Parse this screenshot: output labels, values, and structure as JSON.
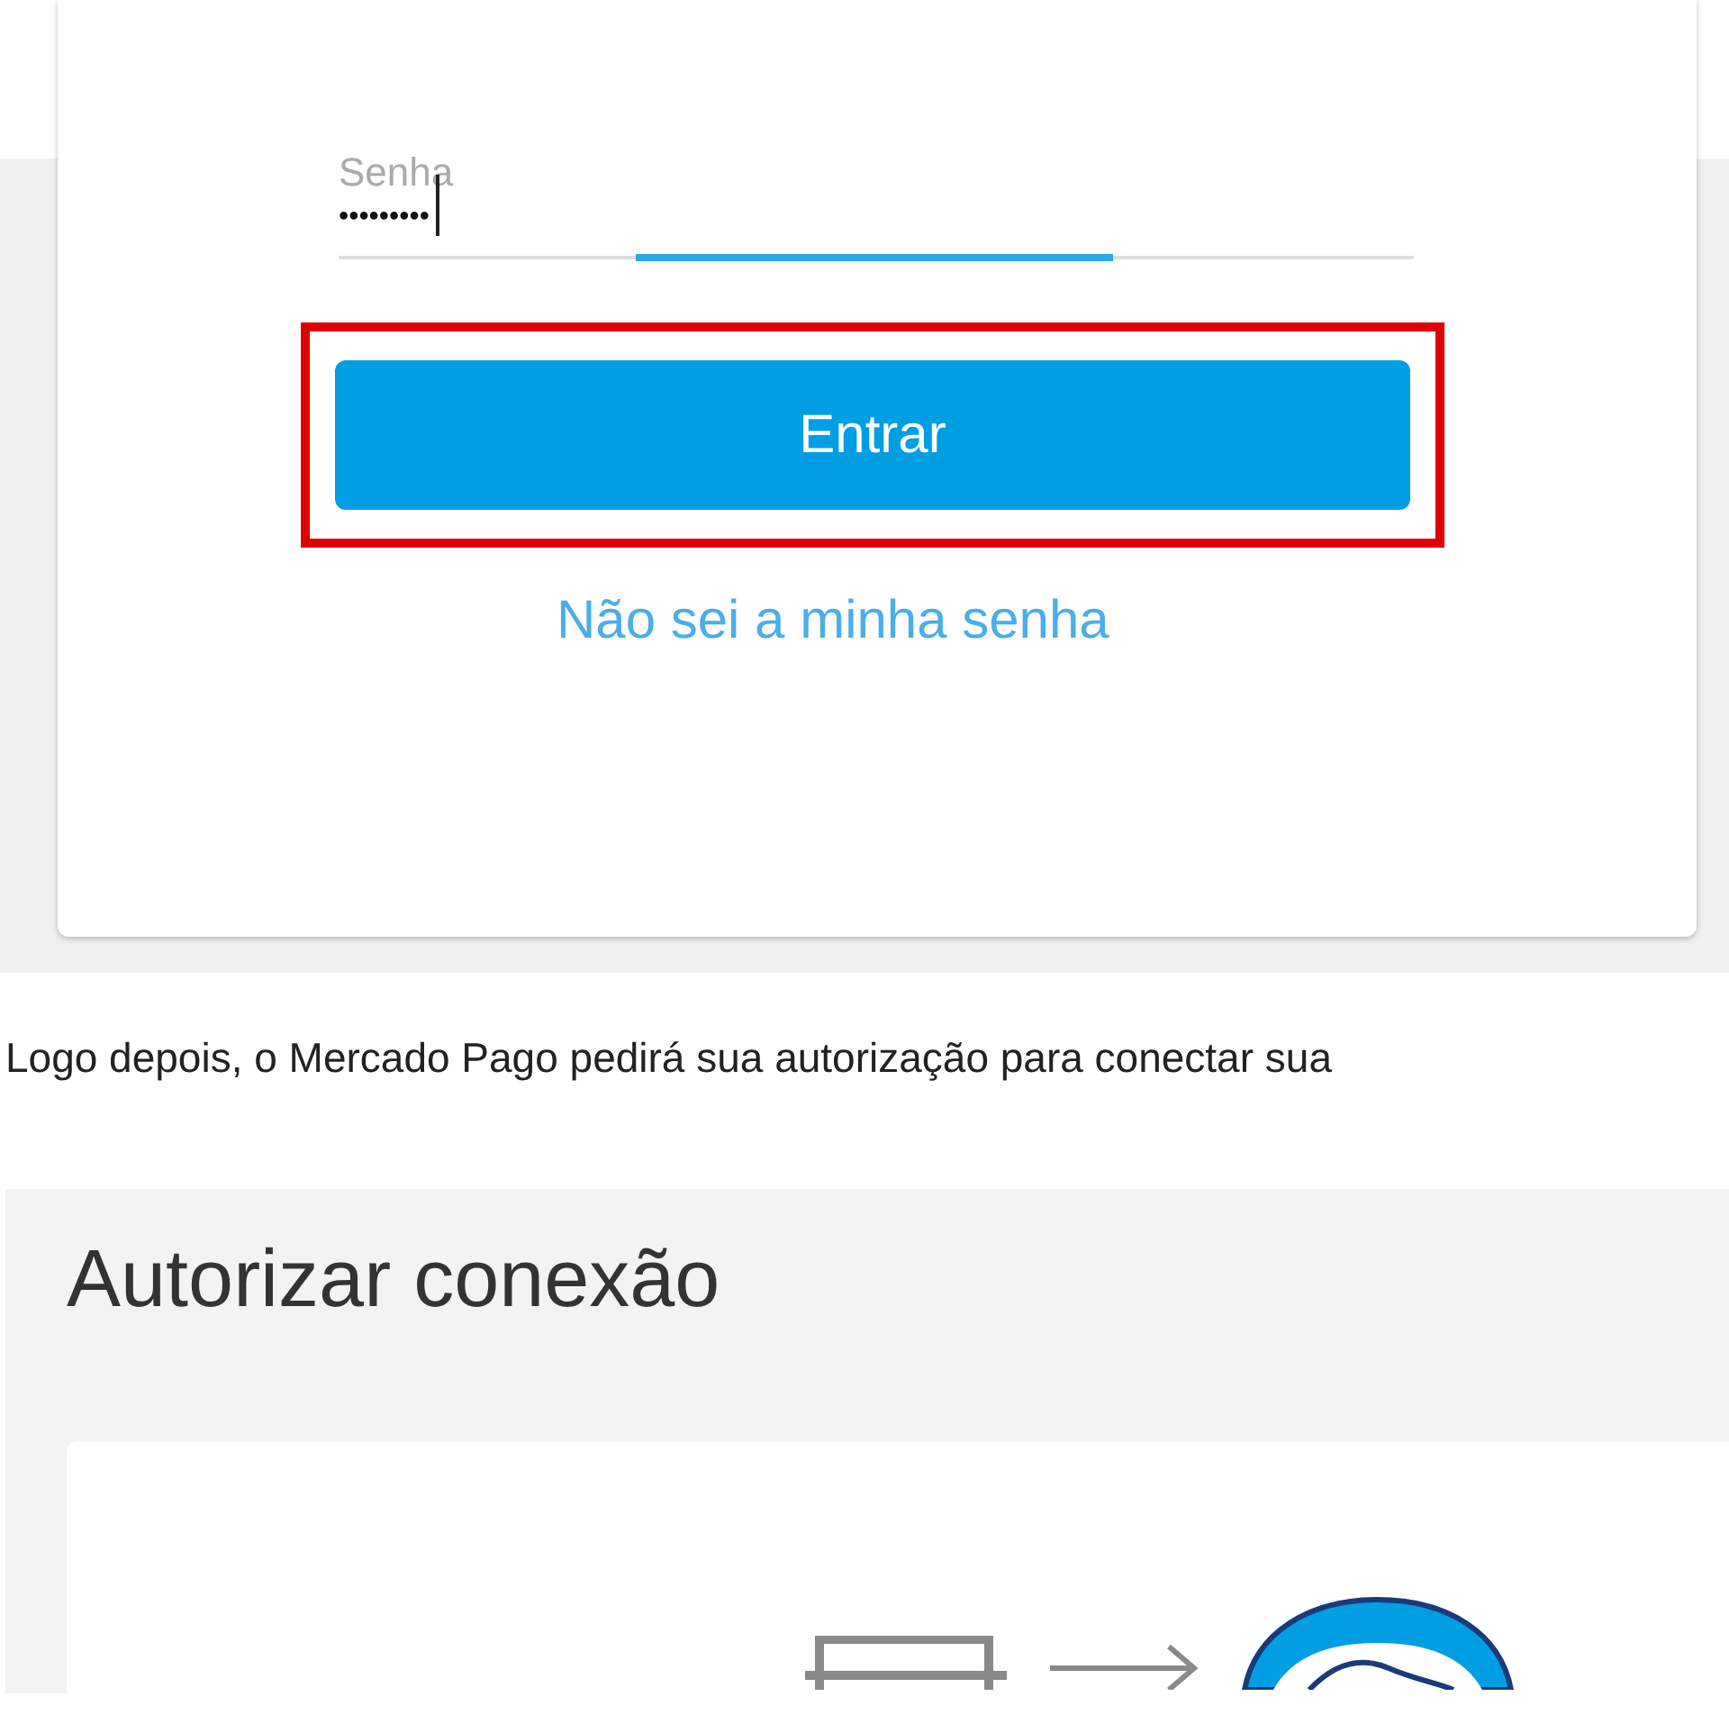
{
  "login_card": {
    "password_field": {
      "label": "Senha",
      "value": "•••••••••",
      "focused": true
    },
    "submit_button": {
      "label": "Entrar",
      "highlighted": true
    },
    "forgot_link": "Não sei a minha senha"
  },
  "paragraph": "Logo depois, o Mercado Pago pedirá sua autorização para conectar sua",
  "authorize_panel": {
    "title": "Autorizar conexão"
  }
}
